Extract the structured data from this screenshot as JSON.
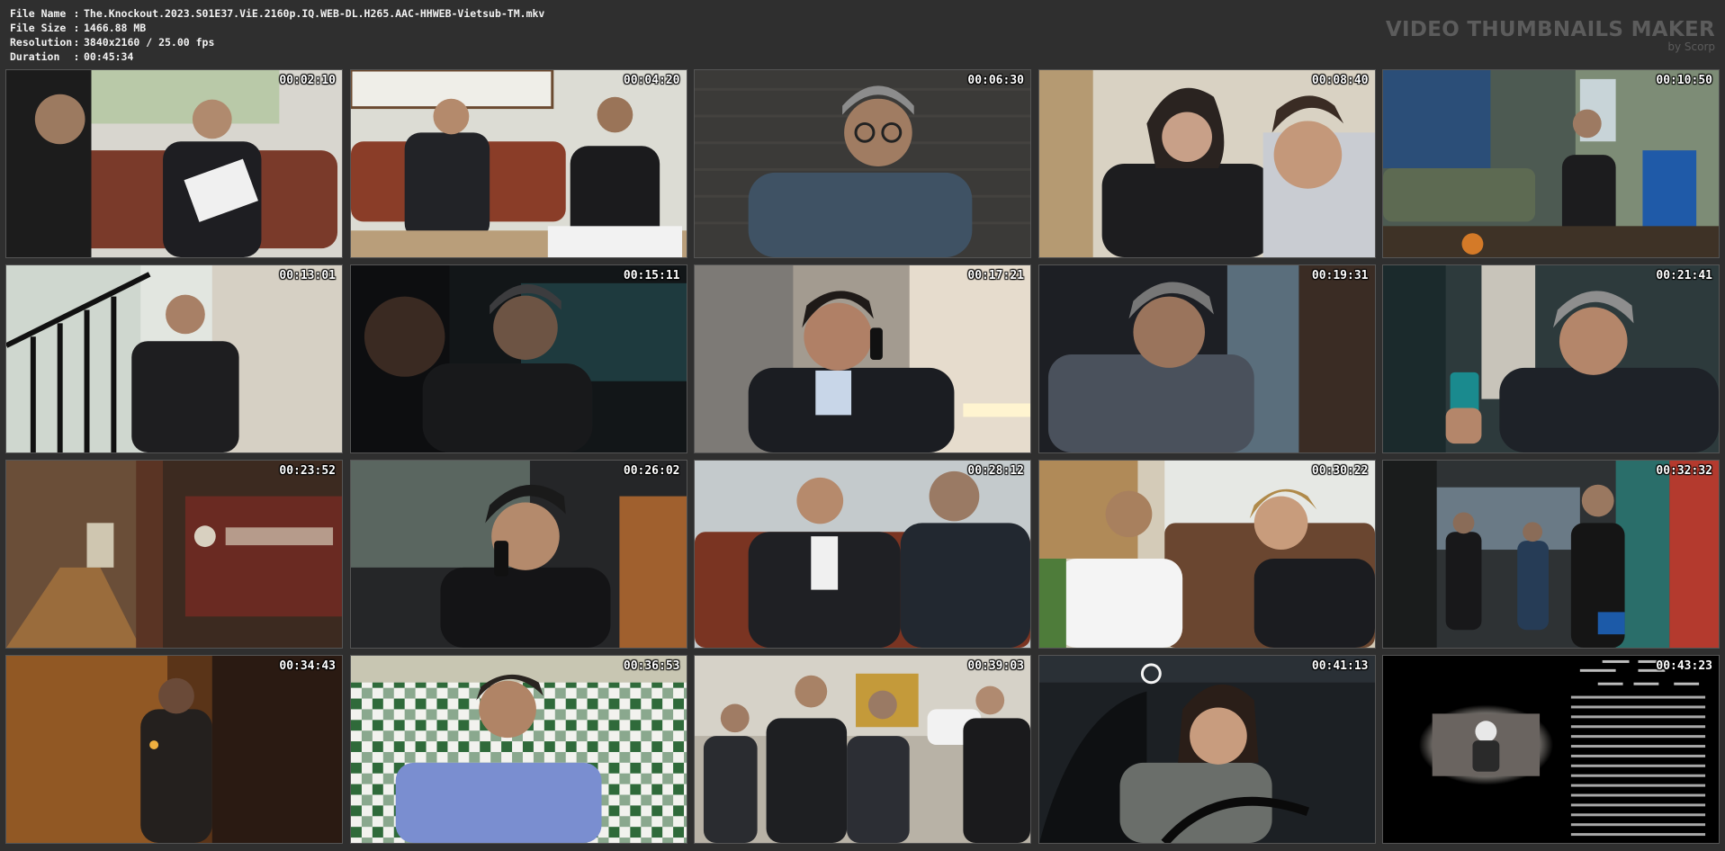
{
  "file_info": {
    "rows": [
      {
        "label": "File Name",
        "sep": ":",
        "value": "The.Knockout.2023.S01E37.ViE.2160p.IQ.WEB-DL.H265.AAC-HHWEB-Vietsub-TM.mkv"
      },
      {
        "label": "File Size",
        "sep": ":",
        "value": "1466.88 MB"
      },
      {
        "label": "Resolution",
        "sep": ":",
        "value": "3840x2160 / 25.00 fps"
      },
      {
        "label": "Duration",
        "sep": ":",
        "value": "00:45:34"
      }
    ]
  },
  "watermark": {
    "title": "VIDEO THUMBNAILS MAKER",
    "subtitle": "by Scorp"
  },
  "thumbnails": [
    {
      "time": "00:02:10",
      "scene": "office-sofa-two-men-papers"
    },
    {
      "time": "00:04:20",
      "scene": "office-sofa-meeting"
    },
    {
      "time": "00:06:30",
      "scene": "man-glasses-grey-hair"
    },
    {
      "time": "00:08:40",
      "scene": "woman-glasses-reading"
    },
    {
      "time": "00:10:50",
      "scene": "living-room-woman-standing"
    },
    {
      "time": "00:13:01",
      "scene": "man-sitting-stairs"
    },
    {
      "time": "00:15:11",
      "scene": "men-in-dark-car"
    },
    {
      "time": "00:17:21",
      "scene": "man-on-phone-glasses"
    },
    {
      "time": "00:19:31",
      "scene": "man-crying-window"
    },
    {
      "time": "00:21:41",
      "scene": "man-looking-at-phone"
    },
    {
      "time": "00:23:52",
      "scene": "hallway-office-sign"
    },
    {
      "time": "00:26:02",
      "scene": "man-phone-in-car"
    },
    {
      "time": "00:28:12",
      "scene": "two-men-talking-sofa"
    },
    {
      "time": "00:30:22",
      "scene": "man-and-woman-sofa"
    },
    {
      "time": "00:32:32",
      "scene": "night-alley-people"
    },
    {
      "time": "00:34:43",
      "scene": "dark-smoky-room"
    },
    {
      "time": "00:36:53",
      "scene": "man-in-hospital-bed"
    },
    {
      "time": "00:39:03",
      "scene": "men-outside-temple"
    },
    {
      "time": "00:41:13",
      "scene": "woman-driving-car"
    },
    {
      "time": "00:43:23",
      "scene": "end-credits"
    }
  ],
  "colors": {
    "background": "#2f2f2f",
    "header_text": "#f2f2f2",
    "watermark_text": "#5c5c5c",
    "timestamp_text": "#ffffff"
  }
}
